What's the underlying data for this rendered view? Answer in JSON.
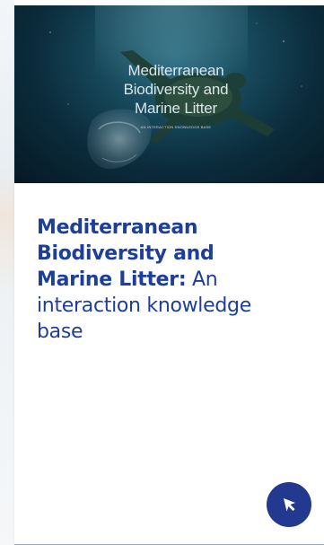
{
  "card": {
    "image": {
      "title_lines": [
        "Mediterranean",
        "Biodiversity and",
        "Marine Litter"
      ],
      "subtitle": "AN INTERACTION KNOWLEDGE BASE"
    },
    "title_strong_lines": [
      "Mediterranean",
      "Biodiversity and",
      "Marine Litter:"
    ],
    "title_rest_inline": "An",
    "title_rest_lines": [
      "interaction knowledge",
      "base"
    ],
    "action_icon": "cursor-arrow-icon"
  },
  "colors": {
    "title": "#1d3f9a",
    "button": "#22398f",
    "hero_dark": "#0b2c3c"
  }
}
